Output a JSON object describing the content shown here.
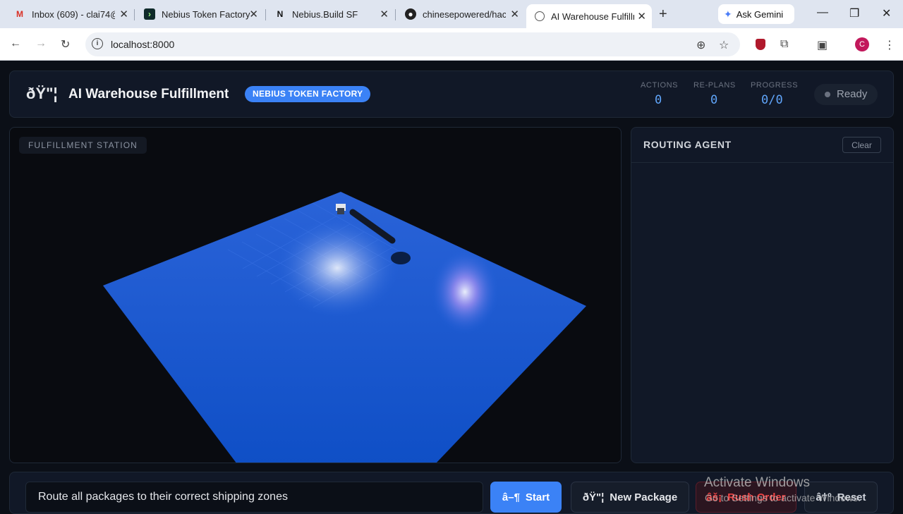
{
  "browser": {
    "tabs": [
      {
        "title": "Inbox (609) - clai74@",
        "favicon": "gmail-icon"
      },
      {
        "title": "Nebius Token Factory",
        "favicon": "nebius-icon"
      },
      {
        "title": "Nebius.Build SF",
        "favicon": "nebius-build-icon"
      },
      {
        "title": "chinesepowered/hac",
        "favicon": "github-icon"
      },
      {
        "title": "AI Warehouse Fulfilln",
        "favicon": "globe-icon"
      }
    ],
    "gemini_label": "Ask Gemini",
    "url": "localhost:8000",
    "avatar_letter": "C"
  },
  "header": {
    "logo_glyph": "ðŸ\"¦",
    "title": "AI Warehouse Fulfillment",
    "badge": "NEBIUS TOKEN FACTORY",
    "stats": [
      {
        "label": "ACTIONS",
        "value": "0"
      },
      {
        "label": "RE-PLANS",
        "value": "0"
      },
      {
        "label": "PROGRESS",
        "value": "0/0"
      }
    ],
    "status": "Ready"
  },
  "scene": {
    "tag": "FULFILLMENT STATION",
    "floor_color": "#1f63e0"
  },
  "agent": {
    "title": "ROUTING AGENT",
    "clear_label": "Clear"
  },
  "controls": {
    "task_value": "Route all packages to their correct shipping zones",
    "start_glyph": "â–¶",
    "start_label": "Start",
    "new_glyph": "ðŸ\"¦",
    "new_label": "New Package",
    "rush_glyph": "âš¡",
    "rush_label": "Rush Order",
    "reset_glyph": "â†º",
    "reset_label": "Reset"
  },
  "watermark": {
    "line1": "Activate Windows",
    "line2": "Go to Settings to activate Windows."
  }
}
